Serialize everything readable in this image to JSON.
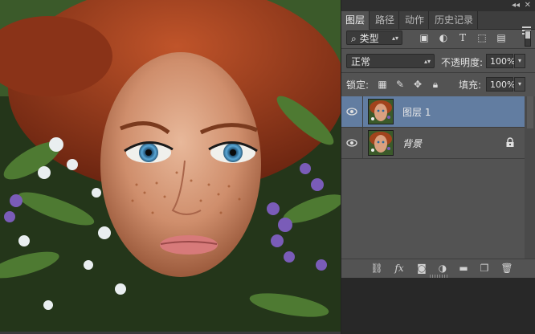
{
  "panel": {
    "tabs": [
      {
        "label": "图层",
        "active": true
      },
      {
        "label": "路径",
        "active": false
      },
      {
        "label": "动作",
        "active": false
      },
      {
        "label": "历史记录",
        "active": false
      }
    ],
    "filter": {
      "label": "类型",
      "icons": [
        "image-filter-icon",
        "adjustment-filter-icon",
        "type-filter-icon",
        "shape-filter-icon",
        "smart-object-filter-icon"
      ]
    },
    "blend_mode": "正常",
    "opacity_label": "不透明度:",
    "opacity_value": "100%",
    "lock_label": "锁定:",
    "fill_label": "填充:",
    "fill_value": "100%"
  },
  "layers": [
    {
      "name": "图层 1",
      "selected": true,
      "visible": true,
      "locked": false,
      "italic": false
    },
    {
      "name": "背景",
      "selected": false,
      "visible": true,
      "locked": true,
      "italic": true
    }
  ],
  "bottom_icons": [
    "link-layers-icon",
    "fx-icon",
    "add-mask-icon",
    "adjustment-layer-icon",
    "new-group-icon",
    "new-layer-icon",
    "delete-layer-icon"
  ],
  "colors": {
    "panel_bg": "#535353",
    "selected_layer": "#627da1",
    "tab_bar": "#3e3e3e"
  }
}
